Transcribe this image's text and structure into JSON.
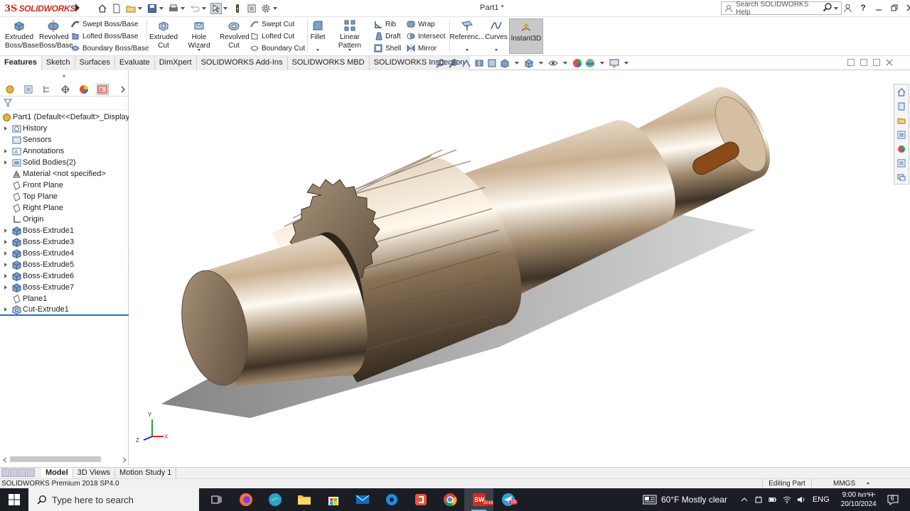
{
  "app": {
    "logo_text": "SOLIDWORKS",
    "document_title": "Part1 *",
    "search_placeholder": "Search SOLIDWORKS Help"
  },
  "command_manager": {
    "extruded_boss": "Extruded Boss/Base",
    "revolved_boss": "Revolved Boss/Base",
    "swept_boss": "Swept Boss/Base",
    "lofted_boss": "Lofted Boss/Base",
    "boundary_boss": "Boundary Boss/Base",
    "extruded_cut": "Extruded Cut",
    "hole_wizard": "Hole Wizard",
    "revolved_cut": "Revolved Cut",
    "swept_cut": "Swept Cut",
    "lofted_cut": "Lofted Cut",
    "boundary_cut": "Boundary Cut",
    "fillet": "Fillet",
    "linear_pattern": "Linear Pattern",
    "rib": "Rib",
    "draft": "Draft",
    "shell": "Shell",
    "wrap": "Wrap",
    "intersect": "Intersect",
    "mirror": "Mirror",
    "reference": "Referenc...",
    "curves": "Curves",
    "instant3d": "Instant3D"
  },
  "tabs": [
    "Features",
    "Sketch",
    "Surfaces",
    "Evaluate",
    "DimXpert",
    "SOLIDWORKS Add-Ins",
    "SOLIDWORKS MBD",
    "SOLIDWORKS Inspection"
  ],
  "tree": {
    "root": "Part1  (Default<<Default>_Display S",
    "items": [
      {
        "label": "History",
        "expand": true,
        "icon": "history-icon"
      },
      {
        "label": "Sensors",
        "expand": false,
        "icon": "sensor-icon"
      },
      {
        "label": "Annotations",
        "expand": true,
        "icon": "annotation-icon"
      },
      {
        "label": "Solid Bodies(2)",
        "expand": true,
        "icon": "solid-bodies-icon"
      },
      {
        "label": "Material <not specified>",
        "expand": false,
        "icon": "material-icon"
      },
      {
        "label": "Front Plane",
        "expand": false,
        "icon": "plane-icon"
      },
      {
        "label": "Top Plane",
        "expand": false,
        "icon": "plane-icon"
      },
      {
        "label": "Right Plane",
        "expand": false,
        "icon": "plane-icon"
      },
      {
        "label": "Origin",
        "expand": false,
        "icon": "origin-icon"
      },
      {
        "label": "Boss-Extrude1",
        "expand": true,
        "icon": "extrude-icon"
      },
      {
        "label": "Boss-Extrude3",
        "expand": true,
        "icon": "extrude-icon"
      },
      {
        "label": "Boss-Extrude4",
        "expand": true,
        "icon": "extrude-icon"
      },
      {
        "label": "Boss-Extrude5",
        "expand": true,
        "icon": "extrude-icon"
      },
      {
        "label": "Boss-Extrude6",
        "expand": true,
        "icon": "extrude-icon"
      },
      {
        "label": "Boss-Extrude7",
        "expand": true,
        "icon": "extrude-icon"
      },
      {
        "label": "Plane1",
        "expand": false,
        "icon": "plane-icon"
      },
      {
        "label": "Cut-Extrude1",
        "expand": true,
        "icon": "cut-extrude-icon"
      }
    ]
  },
  "model_tabs": [
    "Model",
    "3D Views",
    "Motion Study 1"
  ],
  "status": {
    "product": "SOLIDWORKS Premium 2018 SP4.0",
    "mode": "Editing Part",
    "units": "MMGS"
  },
  "taskbar": {
    "search_placeholder": "Type here to search",
    "weather": "60°F  Mostly clear",
    "language": "ENG",
    "time": "9:00 ከሰዓት",
    "date": "20/10/2024",
    "notification_count": "6",
    "sw_badge": "2018",
    "telegram_badge": "15"
  },
  "triad": {
    "x": "X",
    "y": "Y",
    "z": "Z"
  },
  "colors": {
    "accent": "#d52b1e",
    "selection": "#1f6fd1",
    "taskbar_bg": "#1a1e24"
  }
}
